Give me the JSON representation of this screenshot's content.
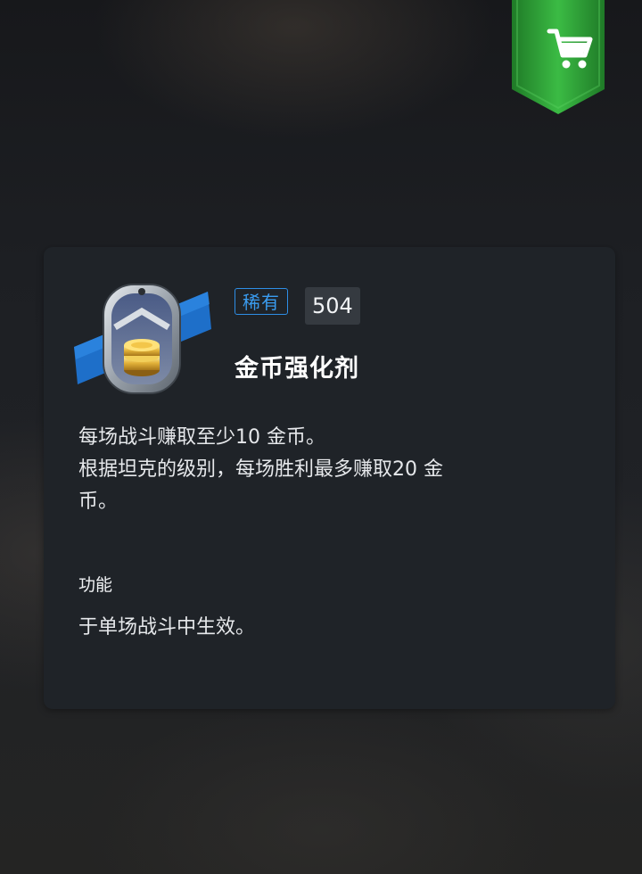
{
  "colors": {
    "card_background": "#1f2328",
    "rarity_accent": "#2e8ee6",
    "shop_green": "#2fa538",
    "count_background": "#353a40"
  },
  "shop": {
    "icon": "shopping-cart-icon"
  },
  "item": {
    "icon": "coin-booster-tag-icon",
    "rarity": "稀有",
    "count": "504",
    "name": "金币强化剂",
    "description_lines": [
      "每场战斗赚取至少10 金币。",
      "根据坦克的级别，每场胜利最多赚取20 金",
      "币。"
    ],
    "function_heading": "功能",
    "function_text": "于单场战斗中生效。"
  }
}
